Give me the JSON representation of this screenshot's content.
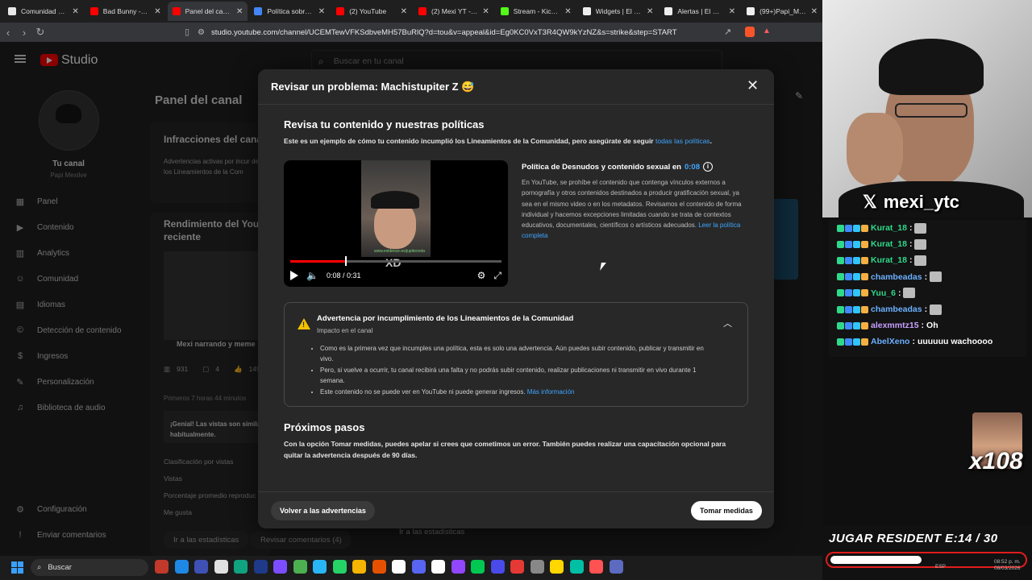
{
  "browser": {
    "tabs": [
      {
        "title": "Comunidad Calvexo",
        "color": "#e8e8e8",
        "active": false
      },
      {
        "title": "Bad Bunny - Tití Me",
        "color": "#ff0000",
        "active": false
      },
      {
        "title": "Panel del canal",
        "color": "#ff0000",
        "active": true
      },
      {
        "title": "Política sobre Imág",
        "color": "#4285f4",
        "active": false
      },
      {
        "title": "(2) YouTube",
        "color": "#ff0000",
        "active": false
      },
      {
        "title": "(2) Mexi YT - YouTu",
        "color": "#ff0000",
        "active": false
      },
      {
        "title": "Stream - Kick D",
        "color": "#53fc18",
        "active": false
      },
      {
        "title": "Widgets | El mejor s",
        "color": "#eeeeee",
        "active": false
      },
      {
        "title": "Alertas | El mejor so",
        "color": "#eeeeee",
        "active": false
      },
      {
        "title": "(99+)Papi_Mexi (6",
        "color": "#eeeeee",
        "active": false
      }
    ],
    "url": "studio.youtube.com/channel/UCEMTewVFKSdbveMH57BuRlQ?d=tou&v=appeal&id=Eg0KC0VxT3R4QW9kYzNZ&s=strike&step=START"
  },
  "studio": {
    "brand": "Studio",
    "search_placeholder": "Buscar en tu canal",
    "channel_label": "Tu canal",
    "channel_name": "Papi Mexilve",
    "nav": [
      {
        "label": "Panel",
        "icon": "dashboard-icon",
        "glyph": "▦"
      },
      {
        "label": "Contenido",
        "icon": "content-icon",
        "glyph": "▶"
      },
      {
        "label": "Analytics",
        "icon": "analytics-icon",
        "glyph": "▥"
      },
      {
        "label": "Comunidad",
        "icon": "community-icon",
        "glyph": "☺"
      },
      {
        "label": "Idiomas",
        "icon": "subtitles-icon",
        "glyph": "▤"
      },
      {
        "label": "Detección de contenido",
        "icon": "copyright-icon",
        "glyph": "©"
      },
      {
        "label": "Ingresos",
        "icon": "earn-icon",
        "glyph": "$"
      },
      {
        "label": "Personalización",
        "icon": "customization-icon",
        "glyph": "✎"
      },
      {
        "label": "Biblioteca de audio",
        "icon": "audio-library-icon",
        "glyph": "♫"
      }
    ],
    "nav_bottom": [
      {
        "label": "Configuración",
        "icon": "gear-icon",
        "glyph": "⚙"
      },
      {
        "label": "Enviar comentarios",
        "icon": "feedback-icon",
        "glyph": "!"
      }
    ],
    "dashboard_title": "Panel del canal",
    "infractions_title": "Infracciones del canal",
    "infractions_text": "Advertencias activas por incur de los Lineamientos de la Com",
    "performance_title": "Rendimiento del YouT reciente",
    "video_stub": "Mexi narrando y meme",
    "stats": [
      "931",
      "4",
      "149"
    ],
    "first_hours": "Primeros 7 horas 44 minutos",
    "great_views": "¡Genial! Las vistas son simila habitualmente.",
    "rank_label": "Clasificación por vistas",
    "metric_views": "Vistas",
    "metric_avg": "Porcentaje promedio reproduc",
    "metric_likes": "Me gusta",
    "go_stats": "Ir a las estadísticas",
    "review_comments": "Revisar comentarios (4)",
    "go_stats2": "Ir a las estadísticas"
  },
  "modal": {
    "title": "Revisar un problema: Machistupiter Z 😅",
    "section_title": "Revisa tu contenido y nuestras políticas",
    "intro": "Este es un ejemplo de cómo tu contenido incumplió los Lineamientos de la Comunidad, pero asegúrate de seguir ",
    "intro_link": "todas las políticas",
    "video_time": "0:08 / 0:31",
    "video_progress": 0.258,
    "policy_title": "Política de Desnudos y contenido sexual en ",
    "policy_timestamp": "0:08",
    "policy_text": "En YouTube, se prohíbe el contenido que contenga vínculos externos a pornografía y otros contenidos destinados a producir gratificación sexual, ya sea en el mismo video o en los metadatos. Revisamos el contenido de forma individual y hacemos excepciones limitadas cuando se trata de contextos educativos, documentales, científicos o artísticos adecuados. ",
    "policy_link": "Leer la política completa",
    "warning_title": "Advertencia por incumplimiento de los Lineamientos de la Comunidad",
    "warning_sub": "Impacto en el canal",
    "warning_items": [
      "Como es la primera vez que incumples una política, esta es solo una advertencia. Aún puedes subir contenido, publicar y transmitir en vivo.",
      "Pero, si vuelve a ocurrir, tu canal recibirá una falta y no podrás subir contenido, realizar publicaciones ni transmitir en vivo durante 1 semana."
    ],
    "warning_item3": "Este contenido no se puede ver en YouTube ni puede generar ingresos. ",
    "warning_more": "Más información",
    "next_title": "Próximos pasos",
    "next_text": "Con la opción Tomar medidas, puedes apelar si crees que cometimos un error. También puedes realizar una capacitación opcional para quitar la advertencia después de 90 días.",
    "back_button": "Volver a las advertencias",
    "action_button": "Tomar medidas"
  },
  "stream": {
    "x_handle": "mexi_ytc",
    "chat": [
      {
        "user": "Kurat_18",
        "msg": "",
        "emote": true,
        "style": "green"
      },
      {
        "user": "Kurat_18",
        "msg": "",
        "emote": true,
        "style": "green"
      },
      {
        "user": "Kurat_18",
        "msg": "",
        "emote": true,
        "style": "green"
      },
      {
        "user": "chambeadas",
        "msg": "",
        "emote": true,
        "style": "blue"
      },
      {
        "user": "Yuu_6",
        "msg": "",
        "emote": true,
        "style": "green"
      },
      {
        "user": "chambeadas",
        "msg": "",
        "emote": true,
        "style": "blue"
      },
      {
        "user": "alexmmtz15",
        "msg": "Oh",
        "emote": false,
        "style": "purple"
      },
      {
        "user": "AbelXeno",
        "msg": "uuuuuu wachoooo",
        "emote": false,
        "style": "blue"
      }
    ],
    "multiplier": "x108",
    "goal_text": "JUGAR RESIDENT E:14  / 30",
    "goal_progress": 0.467,
    "clock_time": "08:52 p. m.",
    "clock_date": "08/03/2026",
    "lang": "ESP"
  },
  "taskbar": {
    "search_label": "Buscar",
    "icon_colors": [
      "#c0392b",
      "#1e88e5",
      "#3f51b5",
      "#e0e0e0",
      "#10a37f",
      "#1f3a8a",
      "#7c4dff",
      "#4caf50",
      "#29b6f6",
      "#25d366",
      "#f4b400",
      "#e65100",
      "#ffffff",
      "#5865f2",
      "#ffffff",
      "#9146ff",
      "#00c853",
      "#4a4ae8",
      "#e53935",
      "#888888",
      "#ffd600",
      "#00bfa5",
      "#ff5252",
      "#5c6bc0"
    ]
  }
}
